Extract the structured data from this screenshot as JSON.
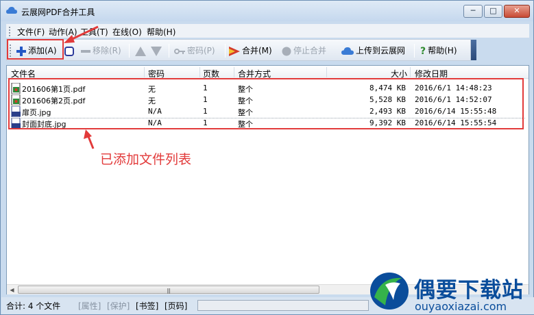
{
  "window": {
    "title": "云展网PDF合并工具"
  },
  "menu": [
    "文件(F)",
    "动作(A)",
    "工具(T)",
    "在线(O)",
    "帮助(H)"
  ],
  "toolbar": {
    "add": "添加(A)",
    "remove": "移除(R)",
    "password": "密码(P)",
    "merge": "合并(M)",
    "stop": "停止合并",
    "upload": "上传到云展网",
    "help": "帮助(H)"
  },
  "columns": {
    "name": "文件名",
    "password": "密码",
    "pages": "页数",
    "mode": "合并方式",
    "size": "大小",
    "modified": "修改日期"
  },
  "rows": [
    {
      "name": "201606第1页.pdf",
      "password": "无",
      "pages": "1",
      "mode": "整个",
      "size": "8,474 KB",
      "modified": "2016/6/1 14:48:23",
      "type": "pdf"
    },
    {
      "name": "201606第2页.pdf",
      "password": "无",
      "pages": "1",
      "mode": "整个",
      "size": "5,528 KB",
      "modified": "2016/6/1 14:52:07",
      "type": "pdf"
    },
    {
      "name": "扉页.jpg",
      "password": "N/A",
      "pages": "1",
      "mode": "整个",
      "size": "2,493 KB",
      "modified": "2016/6/14 15:55:48",
      "type": "jpg"
    },
    {
      "name": "封面封底.jpg",
      "password": "N/A",
      "pages": "1",
      "mode": "整个",
      "size": "9,392 KB",
      "modified": "2016/6/14 15:55:54",
      "type": "jpg"
    }
  ],
  "annotation": "已添加文件列表",
  "status": {
    "total": "合计: 4 个文件",
    "properties": "[属性]",
    "protect": "[保护]",
    "bookmark": "[书签]",
    "pagecode": "[页码]"
  },
  "watermark": {
    "brand": "偶要下载站",
    "url": "ouyaoxiazai.com"
  },
  "colors": {
    "highlight": "#e23a3a",
    "brand": "#0a4d9b"
  }
}
